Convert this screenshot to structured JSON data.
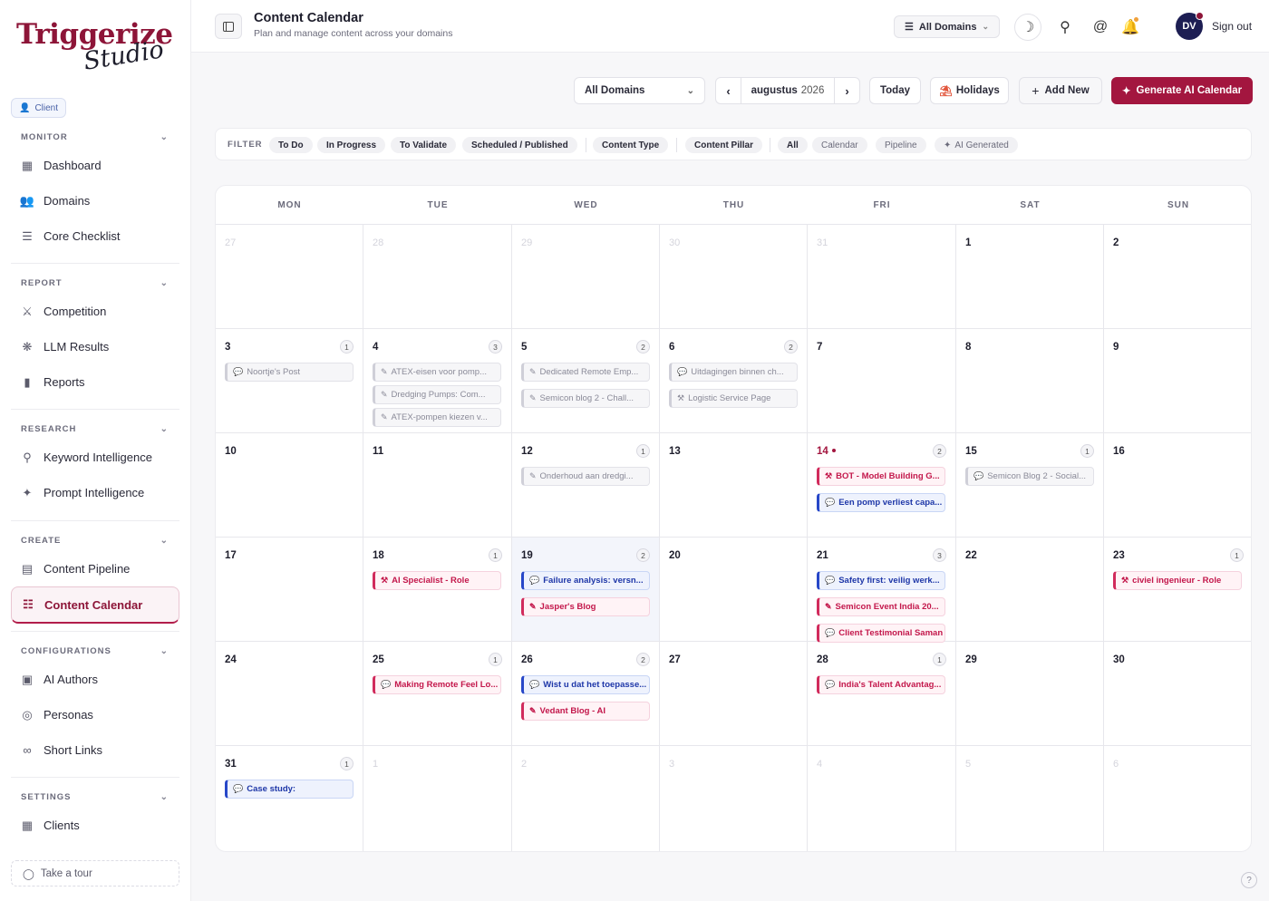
{
  "brand": {
    "name": "Triggerize",
    "sub": "Studio"
  },
  "role": "Client",
  "sidebar": {
    "sections": [
      {
        "title": "MONITOR",
        "items": [
          {
            "label": "Dashboard",
            "icon": "grid-icon"
          },
          {
            "label": "Domains",
            "icon": "users-icon"
          },
          {
            "label": "Core Checklist",
            "icon": "checklist-icon"
          }
        ]
      },
      {
        "title": "REPORT",
        "items": [
          {
            "label": "Competition",
            "icon": "swords-icon"
          },
          {
            "label": "LLM Results",
            "icon": "brain-icon"
          },
          {
            "label": "Reports",
            "icon": "bar-chart-icon"
          }
        ]
      },
      {
        "title": "RESEARCH",
        "items": [
          {
            "label": "Keyword Intelligence",
            "icon": "search-icon"
          },
          {
            "label": "Prompt Intelligence",
            "icon": "sparkles-icon"
          }
        ]
      },
      {
        "title": "CREATE",
        "items": [
          {
            "label": "Content Pipeline",
            "icon": "file-icon"
          },
          {
            "label": "Content Calendar",
            "icon": "calendar-icon"
          }
        ]
      },
      {
        "title": "CONFIGURATIONS",
        "items": [
          {
            "label": "AI Authors",
            "icon": "bot-icon"
          },
          {
            "label": "Personas",
            "icon": "target-icon"
          },
          {
            "label": "Short Links",
            "icon": "link-icon"
          }
        ]
      },
      {
        "title": "SETTINGS",
        "items": [
          {
            "label": "Clients",
            "icon": "building-icon"
          }
        ]
      }
    ],
    "tour": "Take a tour"
  },
  "header": {
    "title": "Content Calendar",
    "subtitle": "Plan and manage content across your domains",
    "domain_select": "All Domains",
    "avatar": "DV",
    "signout": "Sign out"
  },
  "toolbar": {
    "domain": "All Domains",
    "month": "augustus",
    "year": "2026",
    "today": "Today",
    "holidays": "Holidays",
    "add_new": "Add New",
    "generate": "Generate AI Calendar"
  },
  "filters": {
    "label": "FILTER",
    "status": [
      "To Do",
      "In Progress",
      "To Validate",
      "Scheduled / Published"
    ],
    "groups": [
      "Content Type",
      "Content Pillar"
    ],
    "views": [
      "All",
      "Calendar",
      "Pipeline"
    ],
    "ai": "AI Generated"
  },
  "calendar": {
    "weekdays": [
      "MON",
      "TUE",
      "WED",
      "THU",
      "FRI",
      "SAT",
      "SUN"
    ],
    "weeks": [
      [
        {
          "d": "27",
          "other": true
        },
        {
          "d": "28",
          "other": true
        },
        {
          "d": "29",
          "other": true
        },
        {
          "d": "30",
          "other": true
        },
        {
          "d": "31",
          "other": true
        },
        {
          "d": "1"
        },
        {
          "d": "2"
        }
      ],
      [
        {
          "d": "3",
          "count": "1",
          "events": [
            {
              "t": "Noortje's Post",
              "s": "gray",
              "i": "chat"
            }
          ]
        },
        {
          "d": "4",
          "count": "3",
          "events": [
            {
              "t": "ATEX-eisen voor pomp...",
              "s": "gray",
              "i": "pen"
            },
            {
              "t": "Dredging Pumps: Com...",
              "s": "gray",
              "i": "pen"
            },
            {
              "t": "ATEX-pompen kiezen v...",
              "s": "gray",
              "i": "pen"
            }
          ]
        },
        {
          "d": "5",
          "count": "2",
          "events": [
            {
              "t": "Dedicated Remote Emp...",
              "s": "gray",
              "i": "pen"
            },
            {
              "t": "Semicon blog 2 - Chall...",
              "s": "gray",
              "i": "pen"
            }
          ]
        },
        {
          "d": "6",
          "count": "2",
          "events": [
            {
              "t": "Uitdagingen binnen ch...",
              "s": "gray",
              "i": "chat"
            },
            {
              "t": "Logistic Service Page",
              "s": "gray",
              "i": "tool"
            }
          ]
        },
        {
          "d": "7"
        },
        {
          "d": "8"
        },
        {
          "d": "9"
        }
      ],
      [
        {
          "d": "10"
        },
        {
          "d": "11"
        },
        {
          "d": "12",
          "count": "1",
          "events": [
            {
              "t": "Onderhoud aan dredgi...",
              "s": "gray",
              "i": "pen"
            }
          ]
        },
        {
          "d": "13"
        },
        {
          "d": "14",
          "today": true,
          "count": "2",
          "events": [
            {
              "t": "BOT - Model Building G...",
              "s": "pink",
              "i": "tool"
            },
            {
              "t": "Een pomp verliest capa...",
              "s": "blue",
              "i": "chat"
            }
          ]
        },
        {
          "d": "15",
          "count": "1",
          "events": [
            {
              "t": "Semicon Blog 2 - Social...",
              "s": "gray",
              "i": "chat"
            }
          ]
        },
        {
          "d": "16"
        }
      ],
      [
        {
          "d": "17"
        },
        {
          "d": "18",
          "count": "1",
          "events": [
            {
              "t": "AI Specialist - Role",
              "s": "pink",
              "i": "tool"
            }
          ]
        },
        {
          "d": "19",
          "count": "2",
          "hl": true,
          "events": [
            {
              "t": "Failure analysis: versn...",
              "s": "blue",
              "i": "chat"
            },
            {
              "t": "Jasper's Blog",
              "s": "pink",
              "i": "pen"
            }
          ]
        },
        {
          "d": "20"
        },
        {
          "d": "21",
          "count": "3",
          "events": [
            {
              "t": "Safety first: veilig werk...",
              "s": "blue",
              "i": "chat"
            },
            {
              "t": "Semicon Event India 20...",
              "s": "pink",
              "i": "pen"
            },
            {
              "t": "Client Testimonial Saman",
              "s": "pink",
              "i": "chat"
            }
          ]
        },
        {
          "d": "22"
        },
        {
          "d": "23",
          "count": "1",
          "events": [
            {
              "t": "civiel ingenieur - Role",
              "s": "pink",
              "i": "tool"
            }
          ]
        }
      ],
      [
        {
          "d": "24"
        },
        {
          "d": "25",
          "count": "1",
          "events": [
            {
              "t": "Making Remote Feel Lo...",
              "s": "pink",
              "i": "chat"
            }
          ]
        },
        {
          "d": "26",
          "count": "2",
          "events": [
            {
              "t": "Wist u dat het toepasse...",
              "s": "blue",
              "i": "chat"
            },
            {
              "t": "Vedant Blog - AI",
              "s": "pink",
              "i": "pen"
            }
          ]
        },
        {
          "d": "27"
        },
        {
          "d": "28",
          "count": "1",
          "events": [
            {
              "t": "India's Talent Advantag...",
              "s": "pink",
              "i": "chat"
            }
          ]
        },
        {
          "d": "29"
        },
        {
          "d": "30"
        }
      ],
      [
        {
          "d": "31",
          "count": "1",
          "events": [
            {
              "t": "Case study:",
              "s": "blue",
              "i": "chat"
            }
          ]
        },
        {
          "d": "1",
          "other": true
        },
        {
          "d": "2",
          "other": true
        },
        {
          "d": "3",
          "other": true
        },
        {
          "d": "4",
          "other": true
        },
        {
          "d": "5",
          "other": true
        },
        {
          "d": "6",
          "other": true
        }
      ]
    ]
  },
  "help": "?"
}
